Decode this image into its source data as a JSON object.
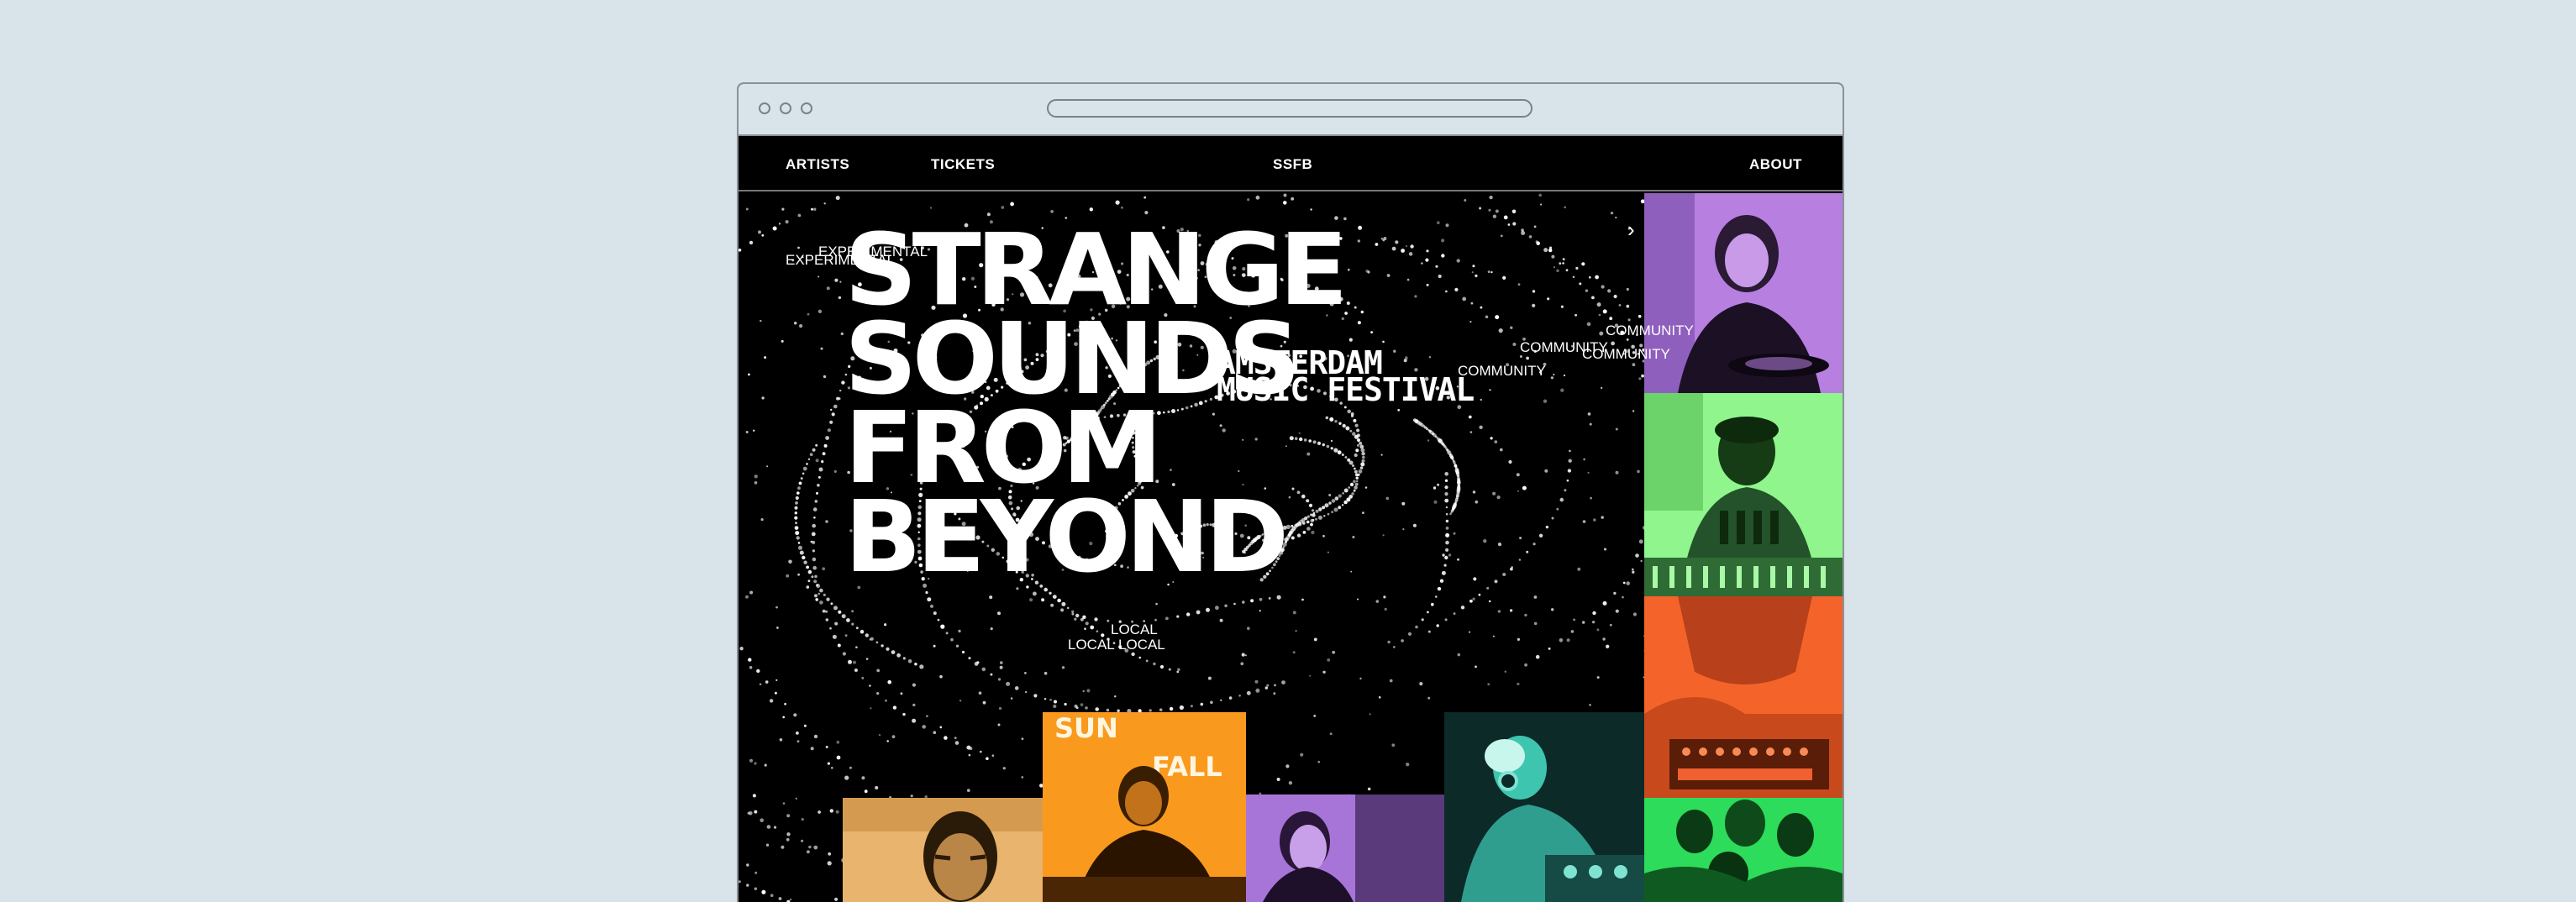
{
  "nav": {
    "left_items": [
      "ARTISTS",
      "TICKETS"
    ],
    "brand": "SSFB",
    "right_items": [
      "ABOUT"
    ]
  },
  "hero": {
    "title_lines": [
      "STRANGE",
      "SOUNDS",
      "FROM",
      "BEYOND"
    ],
    "subtitle_lines": [
      "AMSTERDAM",
      "MUSIC FESTIVAL"
    ]
  },
  "tags": {
    "experimental": "EXPERIMENTAL",
    "community": "COMMUNITY",
    "local": "LOCAL"
  },
  "panels": [
    {
      "name": "artist-photo-dj-purple",
      "color": "#b67fe0"
    },
    {
      "name": "artist-photo-mixer-green",
      "color": "#8ff58c"
    },
    {
      "name": "artist-photo-synth-orange",
      "color": "#f4642a"
    },
    {
      "name": "artist-photo-group-green",
      "color": "#2ddc5a"
    },
    {
      "name": "artist-photo-portrait-yellow",
      "color": "#e8b46e"
    },
    {
      "name": "artist-photo-sunfall-orange",
      "color": "#f99a1e"
    },
    {
      "name": "artist-photo-woman-purple",
      "color": "#a775d8"
    },
    {
      "name": "artist-photo-dj-teal",
      "color": "#3ec5b0"
    }
  ],
  "sunfall_sign": "SUN FALL"
}
